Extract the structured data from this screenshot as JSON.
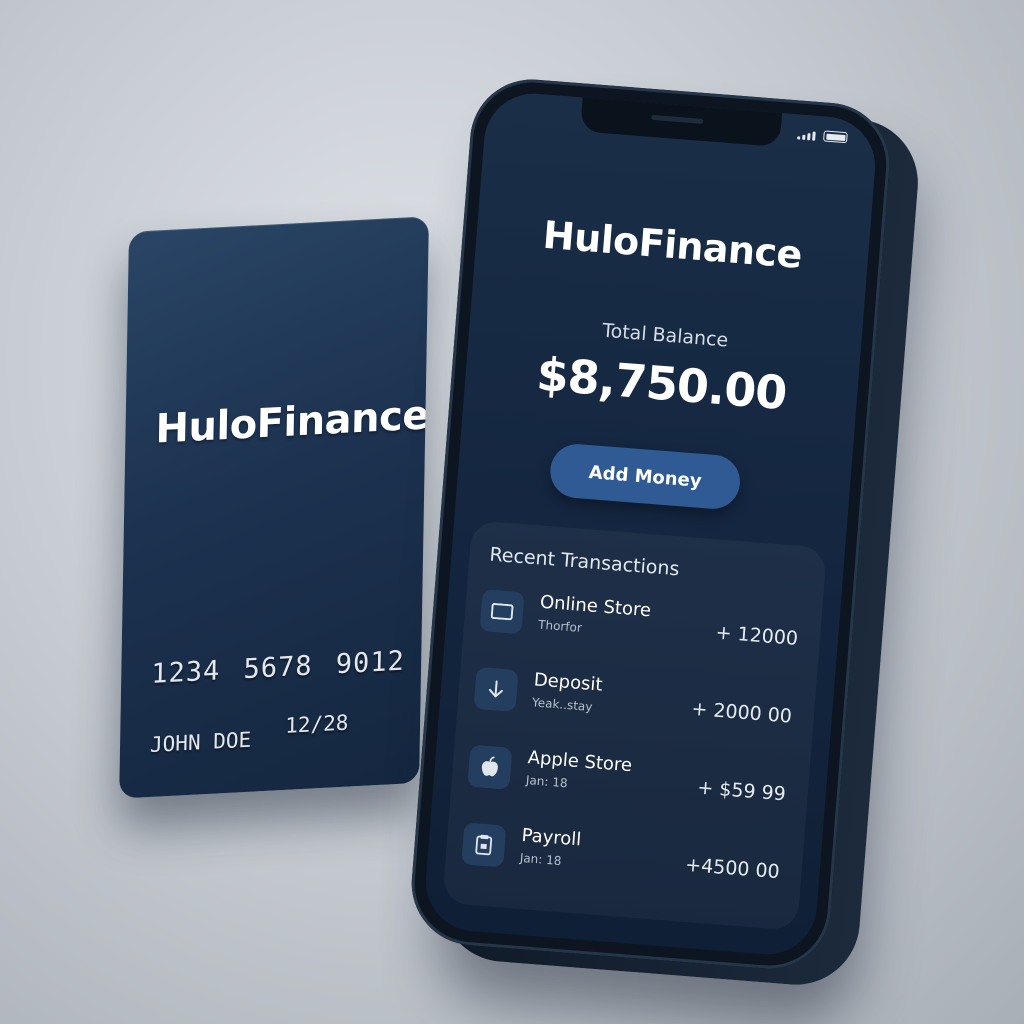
{
  "card": {
    "brand": "HuloFinance",
    "number": "1234 5678 9012",
    "holder": "JOHN DOE",
    "expiry": "12/28"
  },
  "app": {
    "title": "HuloFinance",
    "balance_label": "Total Balance",
    "balance_amount": "$8,750.00",
    "add_money_label": "Add Money",
    "transactions_heading": "Recent Transactions",
    "transactions": [
      {
        "icon": "card-icon",
        "name": "Online Store",
        "date": "Thorfor",
        "amount": "+ 12000"
      },
      {
        "icon": "arrow-down-icon",
        "name": "Deposit",
        "date": "Yeak..stay",
        "amount": "+ 2000 00"
      },
      {
        "icon": "apple-icon",
        "name": "Apple Store",
        "date": "Jan: 18",
        "amount": "+ $59 99"
      },
      {
        "icon": "payroll-icon",
        "name": "Payroll",
        "date": "Jan: 18",
        "amount": "+4500 00"
      }
    ]
  }
}
